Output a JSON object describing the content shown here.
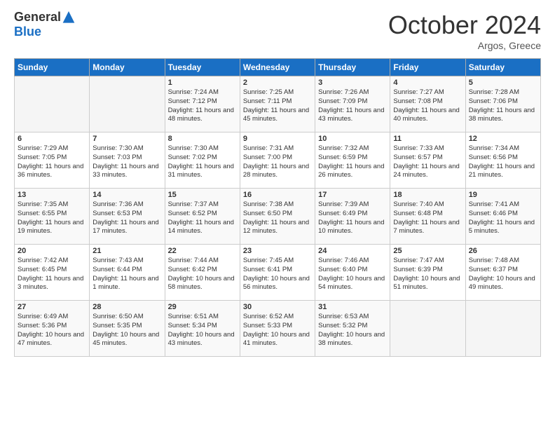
{
  "logo": {
    "general": "General",
    "blue": "Blue"
  },
  "header": {
    "month": "October 2024",
    "location": "Argos, Greece"
  },
  "columns": [
    "Sunday",
    "Monday",
    "Tuesday",
    "Wednesday",
    "Thursday",
    "Friday",
    "Saturday"
  ],
  "weeks": [
    [
      {
        "day": "",
        "info": ""
      },
      {
        "day": "",
        "info": ""
      },
      {
        "day": "1",
        "info": "Sunrise: 7:24 AM\nSunset: 7:12 PM\nDaylight: 11 hours and 48 minutes."
      },
      {
        "day": "2",
        "info": "Sunrise: 7:25 AM\nSunset: 7:11 PM\nDaylight: 11 hours and 45 minutes."
      },
      {
        "day": "3",
        "info": "Sunrise: 7:26 AM\nSunset: 7:09 PM\nDaylight: 11 hours and 43 minutes."
      },
      {
        "day": "4",
        "info": "Sunrise: 7:27 AM\nSunset: 7:08 PM\nDaylight: 11 hours and 40 minutes."
      },
      {
        "day": "5",
        "info": "Sunrise: 7:28 AM\nSunset: 7:06 PM\nDaylight: 11 hours and 38 minutes."
      }
    ],
    [
      {
        "day": "6",
        "info": "Sunrise: 7:29 AM\nSunset: 7:05 PM\nDaylight: 11 hours and 36 minutes."
      },
      {
        "day": "7",
        "info": "Sunrise: 7:30 AM\nSunset: 7:03 PM\nDaylight: 11 hours and 33 minutes."
      },
      {
        "day": "8",
        "info": "Sunrise: 7:30 AM\nSunset: 7:02 PM\nDaylight: 11 hours and 31 minutes."
      },
      {
        "day": "9",
        "info": "Sunrise: 7:31 AM\nSunset: 7:00 PM\nDaylight: 11 hours and 28 minutes."
      },
      {
        "day": "10",
        "info": "Sunrise: 7:32 AM\nSunset: 6:59 PM\nDaylight: 11 hours and 26 minutes."
      },
      {
        "day": "11",
        "info": "Sunrise: 7:33 AM\nSunset: 6:57 PM\nDaylight: 11 hours and 24 minutes."
      },
      {
        "day": "12",
        "info": "Sunrise: 7:34 AM\nSunset: 6:56 PM\nDaylight: 11 hours and 21 minutes."
      }
    ],
    [
      {
        "day": "13",
        "info": "Sunrise: 7:35 AM\nSunset: 6:55 PM\nDaylight: 11 hours and 19 minutes."
      },
      {
        "day": "14",
        "info": "Sunrise: 7:36 AM\nSunset: 6:53 PM\nDaylight: 11 hours and 17 minutes."
      },
      {
        "day": "15",
        "info": "Sunrise: 7:37 AM\nSunset: 6:52 PM\nDaylight: 11 hours and 14 minutes."
      },
      {
        "day": "16",
        "info": "Sunrise: 7:38 AM\nSunset: 6:50 PM\nDaylight: 11 hours and 12 minutes."
      },
      {
        "day": "17",
        "info": "Sunrise: 7:39 AM\nSunset: 6:49 PM\nDaylight: 11 hours and 10 minutes."
      },
      {
        "day": "18",
        "info": "Sunrise: 7:40 AM\nSunset: 6:48 PM\nDaylight: 11 hours and 7 minutes."
      },
      {
        "day": "19",
        "info": "Sunrise: 7:41 AM\nSunset: 6:46 PM\nDaylight: 11 hours and 5 minutes."
      }
    ],
    [
      {
        "day": "20",
        "info": "Sunrise: 7:42 AM\nSunset: 6:45 PM\nDaylight: 11 hours and 3 minutes."
      },
      {
        "day": "21",
        "info": "Sunrise: 7:43 AM\nSunset: 6:44 PM\nDaylight: 11 hours and 1 minute."
      },
      {
        "day": "22",
        "info": "Sunrise: 7:44 AM\nSunset: 6:42 PM\nDaylight: 10 hours and 58 minutes."
      },
      {
        "day": "23",
        "info": "Sunrise: 7:45 AM\nSunset: 6:41 PM\nDaylight: 10 hours and 56 minutes."
      },
      {
        "day": "24",
        "info": "Sunrise: 7:46 AM\nSunset: 6:40 PM\nDaylight: 10 hours and 54 minutes."
      },
      {
        "day": "25",
        "info": "Sunrise: 7:47 AM\nSunset: 6:39 PM\nDaylight: 10 hours and 51 minutes."
      },
      {
        "day": "26",
        "info": "Sunrise: 7:48 AM\nSunset: 6:37 PM\nDaylight: 10 hours and 49 minutes."
      }
    ],
    [
      {
        "day": "27",
        "info": "Sunrise: 6:49 AM\nSunset: 5:36 PM\nDaylight: 10 hours and 47 minutes."
      },
      {
        "day": "28",
        "info": "Sunrise: 6:50 AM\nSunset: 5:35 PM\nDaylight: 10 hours and 45 minutes."
      },
      {
        "day": "29",
        "info": "Sunrise: 6:51 AM\nSunset: 5:34 PM\nDaylight: 10 hours and 43 minutes."
      },
      {
        "day": "30",
        "info": "Sunrise: 6:52 AM\nSunset: 5:33 PM\nDaylight: 10 hours and 41 minutes."
      },
      {
        "day": "31",
        "info": "Sunrise: 6:53 AM\nSunset: 5:32 PM\nDaylight: 10 hours and 38 minutes."
      },
      {
        "day": "",
        "info": ""
      },
      {
        "day": "",
        "info": ""
      }
    ]
  ]
}
